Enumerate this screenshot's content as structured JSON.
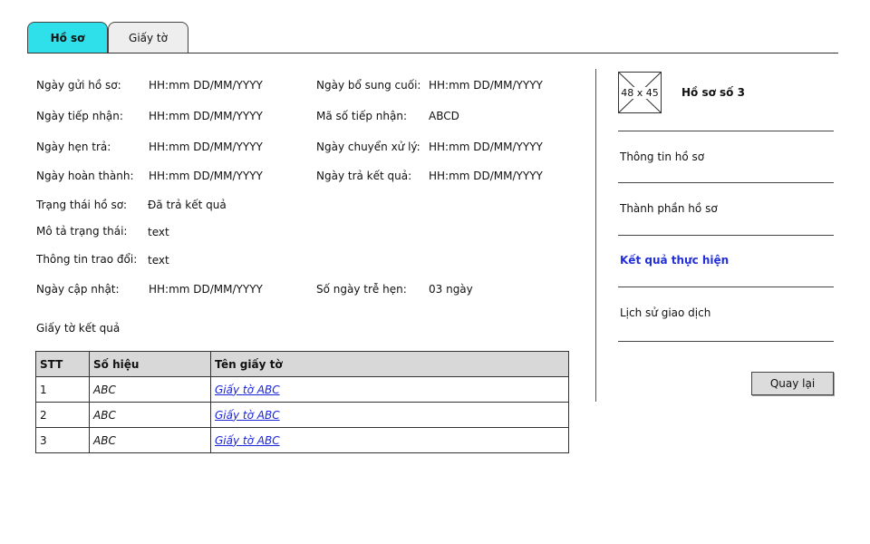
{
  "tabs": [
    {
      "label": "Hồ sơ",
      "active": true
    },
    {
      "label": "Giấy tờ",
      "active": false
    }
  ],
  "info": {
    "ngay_gui": {
      "label": "Ngày gửi hồ sơ:",
      "value": "HH:mm DD/MM/YYYY"
    },
    "ngay_bo_sung": {
      "label": "Ngày bổ sung cuối:",
      "value": "HH:mm DD/MM/YYYY"
    },
    "ngay_tiep_nhan": {
      "label": "Ngày tiếp nhận:",
      "value": "HH:mm DD/MM/YYYY"
    },
    "ma_so": {
      "label": "Mã số tiếp nhận:",
      "value": "ABCD"
    },
    "ngay_hen_tra": {
      "label": "Ngày hẹn trả:",
      "value": "HH:mm DD/MM/YYYY"
    },
    "ngay_chuyen": {
      "label": "Ngày chuyển xử lý:",
      "value": "HH:mm DD/MM/YYYY"
    },
    "ngay_hoan_thanh": {
      "label": "Ngày hoàn thành:",
      "value": "HH:mm DD/MM/YYYY"
    },
    "ngay_tra_kq": {
      "label": "Ngày trả kết quả:",
      "value": "HH:mm DD/MM/YYYY"
    },
    "trang_thai": {
      "label": "Trạng thái hồ sơ:",
      "value": "Đã trả kết quả"
    },
    "mo_ta": {
      "label": "Mô tả trạng thái:",
      "value": "text"
    },
    "trao_doi": {
      "label": "Thông tin trao đổi:",
      "value": "text"
    },
    "ngay_cap_nhat": {
      "label": "Ngày cập nhật:",
      "value": "HH:mm DD/MM/YYYY"
    },
    "so_ngay_tre": {
      "label": "Số ngày trễ hẹn:",
      "value": "03 ngày"
    }
  },
  "result_docs": {
    "heading": "Giấy tờ kết quả",
    "columns": [
      "STT",
      "Số hiệu",
      "Tên giấy tờ"
    ],
    "rows": [
      {
        "stt": "1",
        "so_hieu": "ABC",
        "ten": "Giấy tờ ABC"
      },
      {
        "stt": "2",
        "so_hieu": "ABC",
        "ten": "Giấy tờ ABC"
      },
      {
        "stt": "3",
        "so_hieu": "ABC",
        "ten": "Giấy tờ ABC"
      }
    ]
  },
  "side_panel": {
    "thumbnail_text": "48 x 45",
    "title": "Hồ sơ số 3",
    "items": [
      {
        "label": "Thông tin hồ sơ",
        "active": false
      },
      {
        "label": "Thành phần hồ sơ",
        "active": false
      },
      {
        "label": "Kết quả thực hiện",
        "active": true
      },
      {
        "label": "Lịch sử giao dịch",
        "active": false
      }
    ],
    "back_label": "Quay lại"
  }
}
